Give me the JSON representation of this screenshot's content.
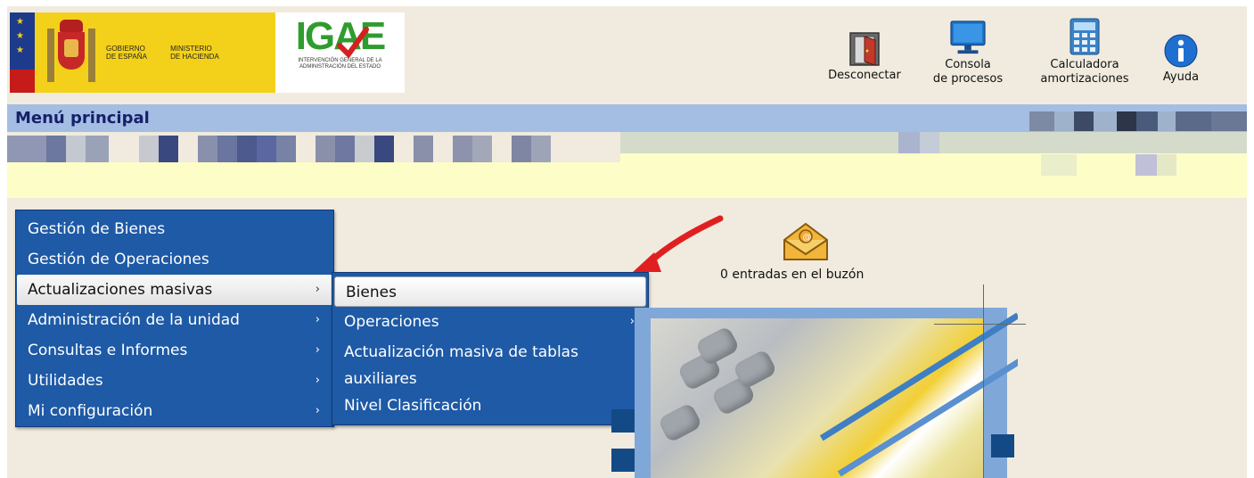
{
  "header": {
    "gov_logo": {
      "line1": "GOBIERNO",
      "line2": "DE ESPAÑA",
      "line3": "MINISTERIO",
      "line4": "DE HACIENDA"
    },
    "igae_logo": {
      "letters": "IGAE",
      "sub1": "INTERVENCIÓN GENERAL DE LA",
      "sub2": "ADMINISTRACIÓN DEL ESTADO"
    },
    "toolbar": [
      {
        "line1": "",
        "line2": "Desconectar",
        "icon": "door-exit-icon"
      },
      {
        "line1": "Consola",
        "line2": "de procesos",
        "icon": "monitor-icon"
      },
      {
        "line1": "Calculadora",
        "line2": "amortizaciones",
        "icon": "calculator-icon"
      },
      {
        "line1": "",
        "line2": "Ayuda",
        "icon": "info-icon"
      }
    ]
  },
  "title": "Menú principal",
  "main_menu": [
    {
      "label": "Gestión de Bienes",
      "has_submenu": false
    },
    {
      "label": "Gestión de Operaciones",
      "has_submenu": false
    },
    {
      "label": "Actualizaciones masivas",
      "has_submenu": true,
      "active": true
    },
    {
      "label": "Administración de la unidad",
      "has_submenu": true
    },
    {
      "label": "Consultas e Informes",
      "has_submenu": true
    },
    {
      "label": "Utilidades",
      "has_submenu": true
    },
    {
      "label": "Mi configuración",
      "has_submenu": true
    }
  ],
  "submenu": [
    {
      "label": "Bienes",
      "selected": true
    },
    {
      "label": "Operaciones",
      "has_submenu": true
    },
    {
      "label": "Actualización masiva de tablas auxiliares"
    },
    {
      "label": "Nivel Clasificación"
    }
  ],
  "mailbox": {
    "text": "0 entradas en el buzón",
    "icon": "mail-envelope-icon"
  },
  "colors": {
    "menu_bg": "#1e5aa6",
    "title_bar": "#a4bee3",
    "title_text": "#16206a",
    "page_bg": "#f0ebde",
    "band_yellow": "#fdfdc8",
    "arrow": "#e02020"
  }
}
